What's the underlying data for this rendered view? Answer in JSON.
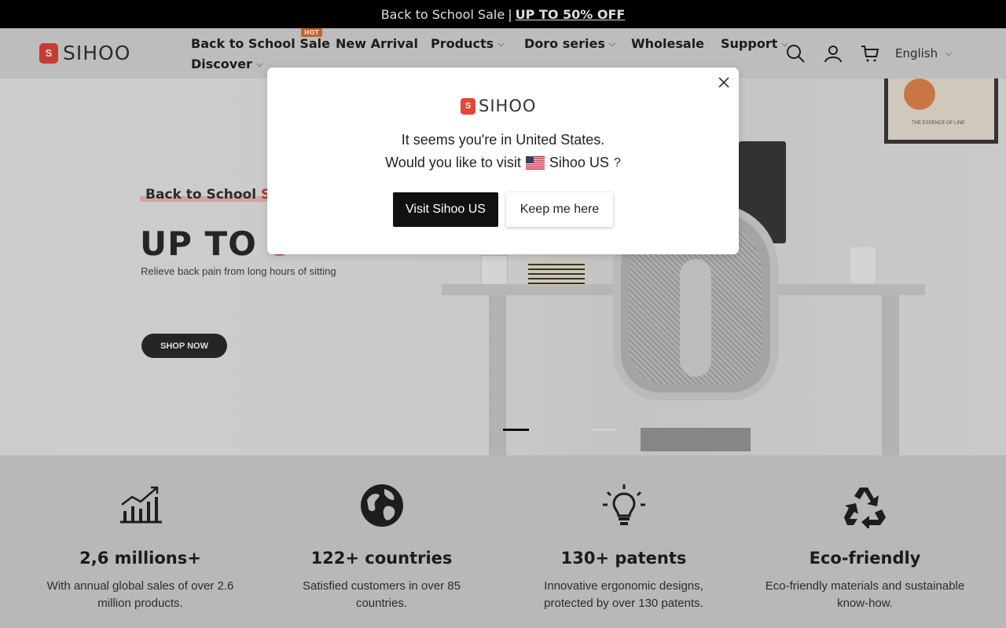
{
  "announcement": {
    "text": "Back to School Sale",
    "separator": "|",
    "link": "UP TO 50% OFF"
  },
  "header": {
    "logo_mark": "S",
    "logo_text": "SIHOO",
    "nav": [
      {
        "label": "Back to School Sale",
        "badge": "HOT"
      },
      {
        "label": "New Arrival"
      },
      {
        "label": "Products",
        "dropdown": true
      },
      {
        "label": "Doro series",
        "dropdown": true
      },
      {
        "label": "Wholesale"
      },
      {
        "label": "Support",
        "dropdown": true
      },
      {
        "label": "Discover",
        "dropdown": true
      }
    ],
    "language": "English",
    "icons": [
      "search-icon",
      "account-icon",
      "cart-icon"
    ]
  },
  "hero": {
    "tag_prefix": "Back to School ",
    "tag_accent": "Sa",
    "title_prefix": "UP TO ",
    "title_accent": "5",
    "subtitle": "Relieve back pain from long hours of sitting",
    "cta": "SHOP NOW",
    "art_text": "THE ESSENCE OF LINE",
    "slides": 2,
    "active_slide": 1
  },
  "stats": [
    {
      "icon": "growth-chart-icon",
      "title": "2,6 millions+",
      "desc": "With annual global sales of over 2.6 million products."
    },
    {
      "icon": "globe-icon",
      "title": "122+ countries",
      "desc": "Satisfied customers in over 85 countries."
    },
    {
      "icon": "lightbulb-icon",
      "title": "130+ patents",
      "desc": "Innovative ergonomic designs, protected by over 130 patents."
    },
    {
      "icon": "recycle-icon",
      "title": "Eco-friendly",
      "desc": "Eco-friendly materials and sustainable know-how."
    }
  ],
  "modal": {
    "logo_mark": "S",
    "logo_text": "SIHOO",
    "line1": "It seems you're in  United States.",
    "line2_prefix": "Would you like to visit",
    "line2_site": "Sihoo US",
    "line2_suffix": "?",
    "flag_icon": "us-flag-icon",
    "visit_button": "Visit Sihoo US",
    "keep_button": "Keep me here"
  },
  "colors": {
    "accent": "#d63b34",
    "logo": "#e2463a",
    "hot_badge": "#e6702a",
    "dark": "#111111"
  }
}
